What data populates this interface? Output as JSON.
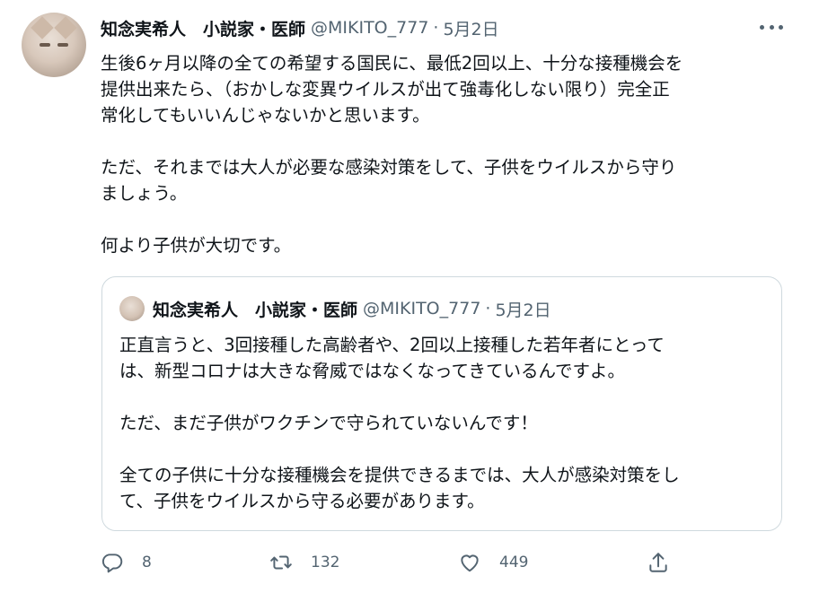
{
  "tweet": {
    "author_name": "知念実希人　小説家・医師",
    "handle": "@MIKITO_777",
    "separator": "·",
    "date": "5月2日",
    "paragraphs": [
      "生後6ヶ月以降の全ての希望する国民に、最低2回以上、十分な接種機会を\n提供出来たら、（おかしな変異ウイルスが出て強毒化しない限り）完全正\n常化してもいいんじゃないかと思います。",
      "ただ、それまでは大人が必要な感染対策をして、子供をウイルスから守り\nましょう。",
      "何より子供が大切です。"
    ]
  },
  "quoted": {
    "author_name": "知念実希人　小説家・医師",
    "handle": "@MIKITO_777",
    "separator": "·",
    "date": "5月2日",
    "paragraphs": [
      "正直言うと、3回接種した高齢者や、2回以上接種した若年者にとって\nは、新型コロナは大きな脅威ではなくなってきているんですよ。",
      "ただ、まだ子供がワクチンで守られていないんです！",
      "全ての子供に十分な接種機会を提供できるまでは、大人が感染対策をし\nて、子供をウイルスから守る必要があります。"
    ]
  },
  "actions": {
    "reply_count": "8",
    "retweet_count": "132",
    "like_count": "449"
  },
  "icons": {
    "more": "more-dots-icon",
    "reply": "reply-icon",
    "retweet": "retweet-icon",
    "like": "heart-icon",
    "share": "share-icon"
  },
  "colors": {
    "text": "#0f1419",
    "secondary": "#536471",
    "border": "#cfd9de"
  }
}
